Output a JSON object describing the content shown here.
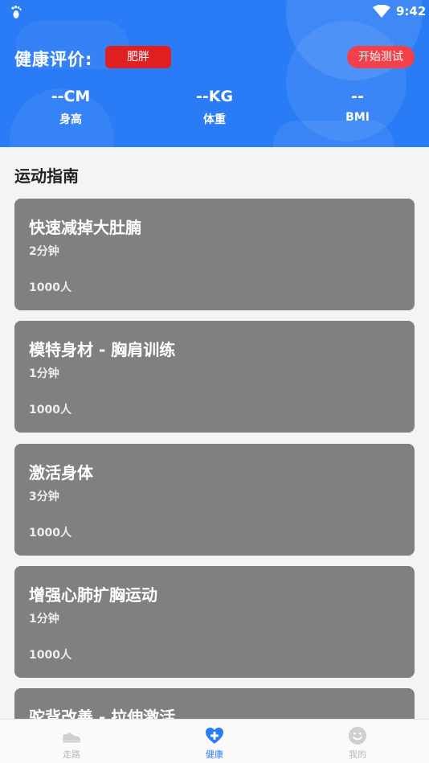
{
  "status_bar": {
    "time": "9:42"
  },
  "header": {
    "eval_label": "健康评价:",
    "eval_result": "肥胖",
    "start_test": "开始测试",
    "stats": [
      {
        "value": "--CM",
        "label": "身高"
      },
      {
        "value": "--KG",
        "label": "体重"
      },
      {
        "value": "--",
        "label": "BMI"
      }
    ]
  },
  "colors": {
    "primary": "#2a7cf6",
    "badge_red": "#e02020",
    "button_red": "#f4404a",
    "card_gray": "#808080"
  },
  "section": {
    "title": "运动指南"
  },
  "cards": [
    {
      "title": "快速减掉大肚腩",
      "duration": "2分钟",
      "count": "1000人"
    },
    {
      "title": "模特身材 - 胸肩训练",
      "duration": "1分钟",
      "count": "1000人"
    },
    {
      "title": "激活身体",
      "duration": "3分钟",
      "count": "1000人"
    },
    {
      "title": "增强心肺扩胸运动",
      "duration": "1分钟",
      "count": "1000人"
    },
    {
      "title": "驼背改善 - 拉伸激活",
      "duration": "",
      "count": ""
    }
  ],
  "nav": {
    "items": [
      {
        "label": "走路",
        "icon": "shoe-icon"
      },
      {
        "label": "健康",
        "icon": "health-plus-icon"
      },
      {
        "label": "我的",
        "icon": "smiley-icon"
      }
    ],
    "active": "健康"
  }
}
